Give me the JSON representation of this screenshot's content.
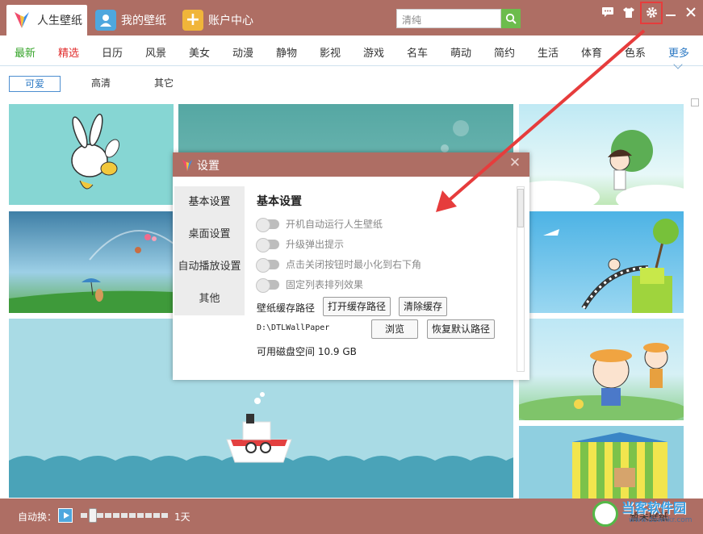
{
  "titlebar": {
    "tabs": [
      {
        "label": "人生壁纸",
        "icon": "app-logo-icon"
      },
      {
        "label": "我的壁纸",
        "icon": "user-icon"
      },
      {
        "label": "账户中心",
        "icon": "plus-icon"
      }
    ],
    "search": {
      "value": "清纯"
    },
    "icons": [
      "chat-icon",
      "tshirt-icon",
      "gear-icon",
      "minimize-icon",
      "close-icon"
    ]
  },
  "categories": [
    "最新",
    "精选",
    "日历",
    "风景",
    "美女",
    "动漫",
    "静物",
    "影视",
    "游戏",
    "名车",
    "萌动",
    "简约",
    "生活",
    "体育",
    "色系",
    "更多"
  ],
  "subtabs": [
    "可爱",
    "高清",
    "其它"
  ],
  "bottom": {
    "auto_label": "自动换：",
    "interval": "1天",
    "watermark": "当客软件园",
    "watermark_sub": "www.downkr.com",
    "right_text": "暂未壁纸"
  },
  "dialog": {
    "title": "设置",
    "menu": [
      "基本设置",
      "桌面设置",
      "自动播放设置",
      "其他"
    ],
    "section_title": "基本设置",
    "options": [
      "开机自动运行人生壁纸",
      "升级弹出提示",
      "点击关闭按钮时最小化到右下角",
      "固定列表排列效果"
    ],
    "cache_label": "壁纸缓存路径",
    "open_cache_btn": "打开缓存路径",
    "clear_cache_btn": "清除缓存",
    "cache_path": "D:\\DTLWallPaper",
    "browse_btn": "浏览",
    "restore_btn": "恢复默认路径",
    "disk_space": "可用磁盘空间  10.9 GB"
  },
  "colors": {
    "titlebar": "#ae6e64",
    "accent_green": "#36a42a",
    "accent_red": "#e12b2b",
    "accent_blue": "#2c79c4",
    "highlight_box": "#e63c3c"
  }
}
